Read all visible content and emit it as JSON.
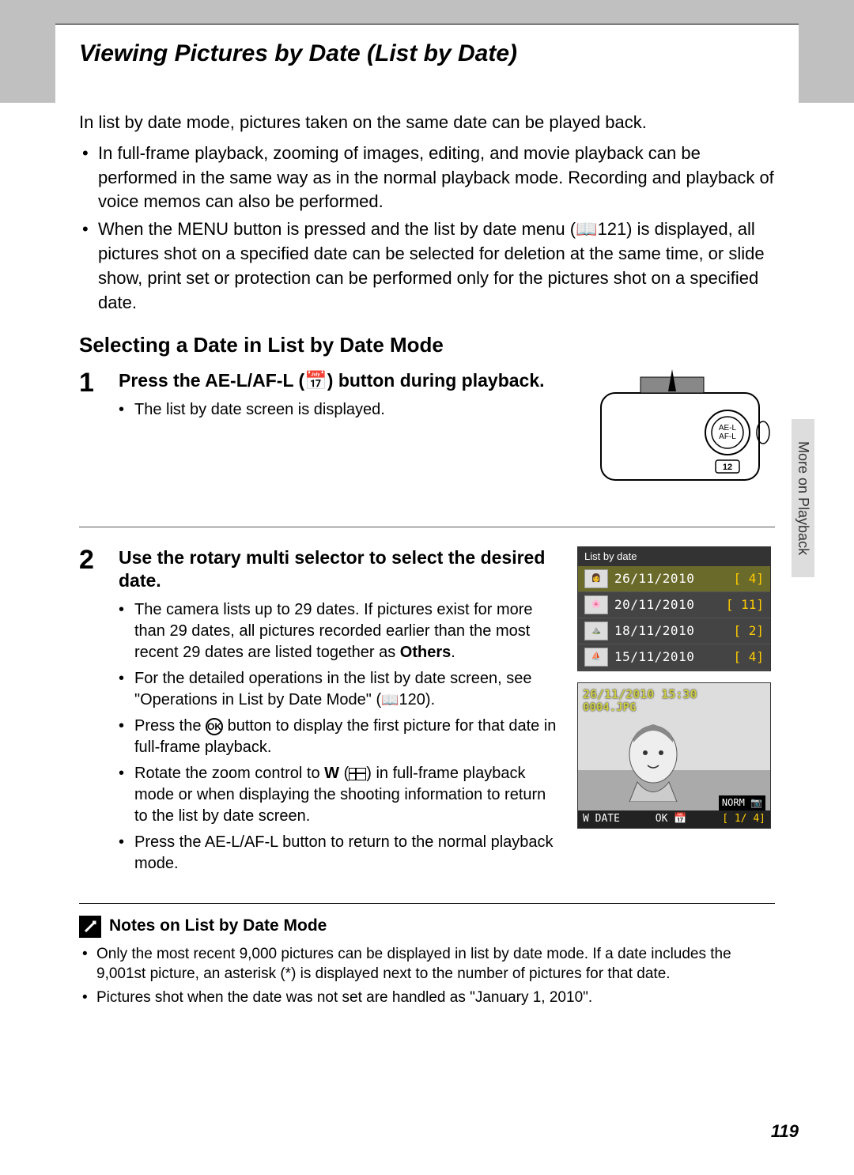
{
  "header": {
    "title": "Viewing Pictures by Date (List by Date)"
  },
  "intro": "In list by date mode, pictures taken on the same date can be played back.",
  "top_bullets": [
    "In full-frame playback, zooming of images, editing, and movie playback can be performed in the same way as in the normal playback mode. Recording and playback of voice memos can also be performed.",
    "When the MENU button is pressed and the list by date menu (📖121) is displayed, all pictures shot on a specified date can be selected for deletion at the same time, or slide show, print set or protection can be performed only for the pictures shot on a specified date."
  ],
  "subheading": "Selecting a Date in List by Date Mode",
  "step1": {
    "num": "1",
    "title_a": "Press the ",
    "title_b": "AE-L/AF-L (📅) button during playback.",
    "bullet": "The list by date screen is displayed."
  },
  "step2": {
    "num": "2",
    "title": "Use the rotary multi selector to select the desired date.",
    "bullets": {
      "b1a": "The camera lists up to 29 dates. If pictures exist for more than 29 dates, all pictures recorded earlier than the most recent 29 dates are listed together as ",
      "b1b": "Others",
      "b1c": ".",
      "b2a": "For the detailed operations in the list by date screen, see \"Operations in List by Date Mode\" (",
      "b2b": "120).",
      "b3a": "Press the ",
      "b3b": " button to display the first picture for that date in full-frame playback.",
      "b4a": "Rotate the zoom control to ",
      "b4b": " in full-frame playback mode or when displaying the shooting information to return to the list by date screen.",
      "b5": "Press the AE-L/AF-L button to return to the normal playback mode."
    }
  },
  "date_screen": {
    "header": "List by date",
    "rows": [
      {
        "date": "26/11/2010",
        "count": "[   4]"
      },
      {
        "date": "20/11/2010",
        "count": "[  11]"
      },
      {
        "date": "18/11/2010",
        "count": "[   2]"
      },
      {
        "date": "15/11/2010",
        "count": "[   4]"
      }
    ]
  },
  "playback": {
    "datetime": "26/11/2010 15:30",
    "file": "0004.JPG",
    "norm": "NORM 📷",
    "bottom_left": "W DATE",
    "bottom_mid": "OK 📅",
    "bottom_right": "[   1/   4]"
  },
  "side_tab": "More on Playback",
  "notes": {
    "title": "Notes on List by Date Mode",
    "items": [
      "Only the most recent 9,000 pictures can be displayed in list by date mode. If a date includes the 9,001st picture, an asterisk (*) is displayed next to the number of pictures for that date.",
      "Pictures shot when the date was not set are handled as \"January 1, 2010\"."
    ]
  },
  "page": "119",
  "icons": {
    "ok": "OK",
    "w": "W",
    "book": "📖"
  }
}
